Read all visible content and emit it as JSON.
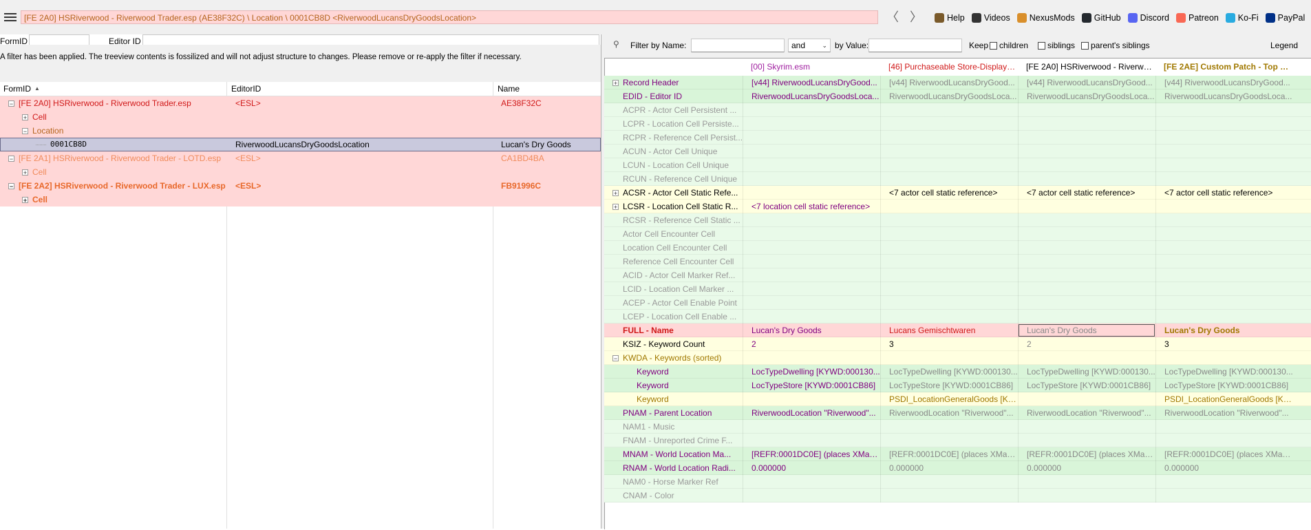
{
  "toolbar": {
    "path": "[FE 2A0] HSRiverwood - Riverwood Trader.esp (AE38F32C) \\ Location \\ 0001CB8D <RiverwoodLucansDryGoodsLocation>",
    "back": "〈",
    "forward": "〉",
    "links": [
      {
        "label": "Help",
        "icon": "book-icon",
        "color": "#7a5a2a"
      },
      {
        "label": "Videos",
        "icon": "video-icon",
        "color": "#333333"
      },
      {
        "label": "NexusMods",
        "icon": "nexus-icon",
        "color": "#d98f2b"
      },
      {
        "label": "GitHub",
        "icon": "github-icon",
        "color": "#24292e"
      },
      {
        "label": "Discord",
        "icon": "discord-icon",
        "color": "#5865f2"
      },
      {
        "label": "Patreon",
        "icon": "patreon-icon",
        "color": "#f96854"
      },
      {
        "label": "Ko-Fi",
        "icon": "kofi-icon",
        "color": "#29abe0"
      },
      {
        "label": "PayPal",
        "icon": "paypal-icon",
        "color": "#003087"
      }
    ]
  },
  "left": {
    "formid_label": "FormID",
    "editorid_label": "Editor ID",
    "filter_notice": "A filter has been applied. The treeview contents is fossilized and will not adjust structure to changes.  Please remove or re-apply the filter if necessary.",
    "columns": [
      "FormID",
      "EditorID",
      "Name"
    ],
    "rows": [
      {
        "indent": 0,
        "exp": "−",
        "formid": "[FE 2A0] HSRiverwood - Riverwood Trader.esp",
        "editorid": "<ESL>",
        "name": "AE38F32C",
        "bg": "#ffd7d7",
        "color": "#d01818"
      },
      {
        "indent": 1,
        "exp": "+",
        "formid": "Cell",
        "editorid": "",
        "name": "",
        "bg": "#ffd7d7",
        "color": "#d01818"
      },
      {
        "indent": 1,
        "exp": "−",
        "formid": "Location",
        "editorid": "",
        "name": "",
        "bg": "#ffd7d7",
        "color": "#b5651d"
      },
      {
        "indent": 2,
        "exp": "",
        "formid": "0001CB8D",
        "editorid": "RiverwoodLucansDryGoodsLocation",
        "name": "Lucan's Dry Goods",
        "bg": "#c9c9dd",
        "color": "#000000",
        "selected": true
      },
      {
        "indent": 0,
        "exp": "−",
        "formid": "[FE 2A1] HSRiverwood - Riverwood Trader - LOTD.esp",
        "editorid": "<ESL>",
        "name": "CA1BD4BA",
        "bg": "#ffd7d7",
        "color": "#f08a5a"
      },
      {
        "indent": 1,
        "exp": "+",
        "formid": "Cell",
        "editorid": "",
        "name": "",
        "bg": "#ffd7d7",
        "color": "#f08a5a"
      },
      {
        "indent": 0,
        "exp": "−",
        "formid": "[FE 2A2] HSRiverwood - Riverwood Trader - LUX.esp",
        "editorid": "<ESL>",
        "name": "FB91996C",
        "bg": "#ffd7d7",
        "color": "#e8682a",
        "bold": true
      },
      {
        "indent": 1,
        "exp": "+",
        "formid": "Cell",
        "editorid": "",
        "name": "",
        "bg": "#ffd7d7",
        "color": "#e8682a",
        "bold": true
      }
    ]
  },
  "right": {
    "filter_label": "Filter by Name:",
    "and_label": "and",
    "by_value_label": "by Value:",
    "keep_label": "Keep",
    "children_label": "children",
    "siblings_label": "siblings",
    "parents_label": "parent's siblings",
    "legend_label": "Legend",
    "plugins": [
      {
        "label": "[00] Skyrim.esm",
        "color": "#a020a0",
        "bold": false
      },
      {
        "label": "[46] Purchaseable Store-Display-It...",
        "color": "#d01818",
        "bold": false
      },
      {
        "label": "[FE 2A0] HSRiverwood - Riverwoo...",
        "color": "#000000",
        "bold": false
      },
      {
        "label": "[FE 2AE] Custom Patch - Top Lev...",
        "color": "#a07800",
        "bold": true
      }
    ],
    "rows": [
      {
        "label": "Record Header",
        "exp": "+",
        "lc": "#800080",
        "bg": "#d9f5d9",
        "cells": [
          "[v44] RiverwoodLucansDryGood...",
          "[v44] RiverwoodLucansDryGood...",
          "[v44] RiverwoodLucansDryGood...",
          "[v44] RiverwoodLucansDryGood..."
        ],
        "cc": [
          "#800080",
          "#888888",
          "#888888",
          "#888888"
        ]
      },
      {
        "label": "EDID - Editor ID",
        "exp": "",
        "lc": "#800080",
        "bg": "#d9f5d9",
        "cells": [
          "RiverwoodLucansDryGoodsLoca...",
          "RiverwoodLucansDryGoodsLoca...",
          "RiverwoodLucansDryGoodsLoca...",
          "RiverwoodLucansDryGoodsLoca..."
        ],
        "cc": [
          "#800080",
          "#888888",
          "#888888",
          "#888888"
        ]
      },
      {
        "label": "ACPR - Actor Cell Persistent ...",
        "exp": "",
        "lc": "#999999",
        "bg": "#e9fae9",
        "cells": [
          "",
          "",
          "",
          ""
        ],
        "cc": [
          "#999999",
          "#999999",
          "#999999",
          "#999999"
        ]
      },
      {
        "label": "LCPR - Location Cell Persiste...",
        "exp": "",
        "lc": "#999999",
        "bg": "#e9fae9",
        "cells": [
          "",
          "",
          "",
          ""
        ],
        "cc": [
          "#999999",
          "#999999",
          "#999999",
          "#999999"
        ]
      },
      {
        "label": "RCPR - Reference Cell Persist...",
        "exp": "",
        "lc": "#999999",
        "bg": "#e9fae9",
        "cells": [
          "",
          "",
          "",
          ""
        ],
        "cc": [
          "#999999",
          "#999999",
          "#999999",
          "#999999"
        ]
      },
      {
        "label": "ACUN - Actor Cell Unique",
        "exp": "",
        "lc": "#999999",
        "bg": "#e9fae9",
        "cells": [
          "",
          "",
          "",
          ""
        ],
        "cc": [
          "#999999",
          "#999999",
          "#999999",
          "#999999"
        ]
      },
      {
        "label": "LCUN - Location Cell Unique",
        "exp": "",
        "lc": "#999999",
        "bg": "#e9fae9",
        "cells": [
          "",
          "",
          "",
          ""
        ],
        "cc": [
          "#999999",
          "#999999",
          "#999999",
          "#999999"
        ]
      },
      {
        "label": "RCUN - Reference Cell Unique",
        "exp": "",
        "lc": "#999999",
        "bg": "#e9fae9",
        "cells": [
          "",
          "",
          "",
          ""
        ],
        "cc": [
          "#999999",
          "#999999",
          "#999999",
          "#999999"
        ]
      },
      {
        "label": "ACSR - Actor Cell Static Refe...",
        "exp": "+",
        "lc": "#000000",
        "bg": "#ffffe0",
        "cells": [
          "",
          "<7 actor cell static reference>",
          "<7 actor cell static reference>",
          "<7 actor cell static reference>"
        ],
        "cc": [
          "#000000",
          "#000000",
          "#000000",
          "#000000"
        ]
      },
      {
        "label": "LCSR - Location Cell Static R...",
        "exp": "+",
        "lc": "#000000",
        "bg": "#ffffe0",
        "cells": [
          "<7 location cell static reference>",
          "",
          "",
          ""
        ],
        "cc": [
          "#800080",
          "#000000",
          "#000000",
          "#000000"
        ]
      },
      {
        "label": "RCSR - Reference Cell Static ...",
        "exp": "",
        "lc": "#999999",
        "bg": "#e9fae9",
        "cells": [
          "",
          "",
          "",
          ""
        ],
        "cc": [
          "#999999",
          "#999999",
          "#999999",
          "#999999"
        ]
      },
      {
        "label": "Actor Cell Encounter Cell",
        "exp": "",
        "lc": "#999999",
        "bg": "#e9fae9",
        "cells": [
          "",
          "",
          "",
          ""
        ],
        "cc": [
          "#999999",
          "#999999",
          "#999999",
          "#999999"
        ]
      },
      {
        "label": "Location Cell Encounter Cell",
        "exp": "",
        "lc": "#999999",
        "bg": "#e9fae9",
        "cells": [
          "",
          "",
          "",
          ""
        ],
        "cc": [
          "#999999",
          "#999999",
          "#999999",
          "#999999"
        ]
      },
      {
        "label": "Reference Cell Encounter Cell",
        "exp": "",
        "lc": "#999999",
        "bg": "#e9fae9",
        "cells": [
          "",
          "",
          "",
          ""
        ],
        "cc": [
          "#999999",
          "#999999",
          "#999999",
          "#999999"
        ]
      },
      {
        "label": "ACID - Actor Cell Marker Ref...",
        "exp": "",
        "lc": "#999999",
        "bg": "#e9fae9",
        "cells": [
          "",
          "",
          "",
          ""
        ],
        "cc": [
          "#999999",
          "#999999",
          "#999999",
          "#999999"
        ]
      },
      {
        "label": "LCID - Location Cell Marker ...",
        "exp": "",
        "lc": "#999999",
        "bg": "#e9fae9",
        "cells": [
          "",
          "",
          "",
          ""
        ],
        "cc": [
          "#999999",
          "#999999",
          "#999999",
          "#999999"
        ]
      },
      {
        "label": "ACEP - Actor Cell Enable Point",
        "exp": "",
        "lc": "#999999",
        "bg": "#e9fae9",
        "cells": [
          "",
          "",
          "",
          ""
        ],
        "cc": [
          "#999999",
          "#999999",
          "#999999",
          "#999999"
        ]
      },
      {
        "label": "LCEP - Location Cell Enable ...",
        "exp": "",
        "lc": "#999999",
        "bg": "#e9fae9",
        "cells": [
          "",
          "",
          "",
          ""
        ],
        "cc": [
          "#999999",
          "#999999",
          "#999999",
          "#999999"
        ]
      },
      {
        "label": "FULL - Name",
        "exp": "",
        "lc": "#d01818",
        "bold": true,
        "bg": "#ffd7d7",
        "cells": [
          "Lucan's Dry Goods",
          "Lucans Gemischtwaren",
          "Lucan's Dry Goods",
          "Lucan's Dry Goods"
        ],
        "cc": [
          "#800080",
          "#d01818",
          "#888888",
          "#a07800"
        ],
        "cb": [
          false,
          false,
          false,
          true
        ],
        "boxed": 2
      },
      {
        "label": "KSIZ - Keyword Count",
        "exp": "",
        "lc": "#000000",
        "bg": "#ffffe0",
        "cells": [
          "2",
          "3",
          "2",
          "3"
        ],
        "cc": [
          "#800080",
          "#000000",
          "#888888",
          "#000000"
        ]
      },
      {
        "label": "KWDA - Keywords (sorted)",
        "exp": "−",
        "lc": "#a07800",
        "bg": "#ffffe0",
        "cells": [
          "",
          "",
          "",
          ""
        ],
        "cc": [
          "#000000",
          "#000000",
          "#000000",
          "#000000"
        ]
      },
      {
        "label": "Keyword",
        "indent": 1,
        "exp": "",
        "lc": "#800080",
        "bg": "#d9f5d9",
        "cells": [
          "LocTypeDwelling [KYWD:000130...",
          "LocTypeDwelling [KYWD:000130...",
          "LocTypeDwelling [KYWD:000130...",
          "LocTypeDwelling [KYWD:000130..."
        ],
        "cc": [
          "#800080",
          "#888888",
          "#888888",
          "#888888"
        ]
      },
      {
        "label": "Keyword",
        "indent": 1,
        "exp": "",
        "lc": "#800080",
        "bg": "#d9f5d9",
        "cells": [
          "LocTypeStore [KYWD:0001CB86]",
          "LocTypeStore [KYWD:0001CB86]",
          "LocTypeStore [KYWD:0001CB86]",
          "LocTypeStore [KYWD:0001CB86]"
        ],
        "cc": [
          "#800080",
          "#888888",
          "#888888",
          "#888888"
        ]
      },
      {
        "label": "Keyword",
        "indent": 1,
        "exp": "",
        "lc": "#a07800",
        "bg": "#ffffe0",
        "cells": [
          "",
          "PSDI_LocationGeneralGoods [KY...",
          "",
          "PSDI_LocationGeneralGoods [KY..."
        ],
        "cc": [
          "#000000",
          "#a07800",
          "#000000",
          "#a07800"
        ]
      },
      {
        "label": "PNAM - Parent Location",
        "exp": "",
        "lc": "#800080",
        "bg": "#d9f5d9",
        "cells": [
          "RiverwoodLocation \"Riverwood\"...",
          "RiverwoodLocation \"Riverwood\"...",
          "RiverwoodLocation \"Riverwood\"...",
          "RiverwoodLocation \"Riverwood\"..."
        ],
        "cc": [
          "#800080",
          "#888888",
          "#888888",
          "#888888"
        ]
      },
      {
        "label": "NAM1 - Music",
        "exp": "",
        "lc": "#999999",
        "bg": "#e9fae9",
        "cells": [
          "",
          "",
          "",
          ""
        ],
        "cc": [
          "#999999",
          "#999999",
          "#999999",
          "#999999"
        ]
      },
      {
        "label": "FNAM - Unreported Crime F...",
        "exp": "",
        "lc": "#999999",
        "bg": "#e9fae9",
        "cells": [
          "",
          "",
          "",
          ""
        ],
        "cc": [
          "#999999",
          "#999999",
          "#999999",
          "#999999"
        ]
      },
      {
        "label": "MNAM - World Location Ma...",
        "exp": "",
        "lc": "#800080",
        "bg": "#d9f5d9",
        "cells": [
          "[REFR:0001DC0E] (places XMarke...",
          "[REFR:0001DC0E] (places XMarke...",
          "[REFR:0001DC0E] (places XMarke...",
          "[REFR:0001DC0E] (places XMarke..."
        ],
        "cc": [
          "#800080",
          "#888888",
          "#888888",
          "#888888"
        ]
      },
      {
        "label": "RNAM - World Location Radi...",
        "exp": "",
        "lc": "#800080",
        "bg": "#d9f5d9",
        "cells": [
          "0.000000",
          "0.000000",
          "0.000000",
          "0.000000"
        ],
        "cc": [
          "#800080",
          "#888888",
          "#888888",
          "#888888"
        ]
      },
      {
        "label": "NAM0 - Horse Marker Ref",
        "exp": "",
        "lc": "#999999",
        "bg": "#e9fae9",
        "cells": [
          "",
          "",
          "",
          ""
        ],
        "cc": [
          "#999999",
          "#999999",
          "#999999",
          "#999999"
        ]
      },
      {
        "label": "CNAM - Color",
        "exp": "",
        "lc": "#999999",
        "bg": "#e9fae9",
        "cells": [
          "",
          "",
          "",
          ""
        ],
        "cc": [
          "#999999",
          "#999999",
          "#999999",
          "#999999"
        ]
      }
    ]
  }
}
